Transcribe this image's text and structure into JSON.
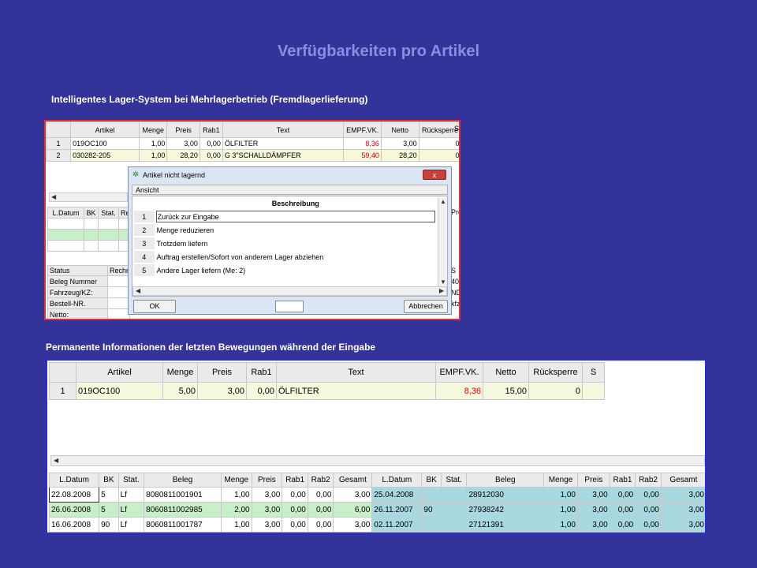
{
  "page": {
    "title": "Verfügbarkeiten pro Artikel",
    "section1_caption": "Intelligentes Lager-System  bei Mehrlagerbetrieb  (Fremdlagerlieferung)",
    "section2_caption": "Permanente Informationen der letzten Bewegungen  während der Eingabe"
  },
  "colors": {
    "background": "#333399",
    "title": "#8c8ce0",
    "frame1": "#e03030",
    "frame2": "#2a2ae0",
    "price_red": "#e00000"
  },
  "shot1": {
    "headers": [
      "",
      "Artikel",
      "Menge",
      "Preis",
      "Rab1",
      "Text",
      "EMPF.VK.",
      "Netto",
      "Rücksperre",
      "S"
    ],
    "rows": [
      [
        "1",
        "019OC100",
        "1,00",
        "3,00",
        "0,00",
        "ÖLFILTER",
        "8,36",
        "3,00",
        "0",
        ""
      ],
      [
        "2",
        "030282-205",
        "1,00",
        "28,20",
        "0,00",
        "G 3\"SCHALLDÄMPFER",
        "59,40",
        "28,20",
        "0",
        ""
      ]
    ],
    "lower_headers": [
      "L.Datum",
      "BK",
      "Stat.",
      "Re"
    ],
    "info_header": [
      "Status",
      "Rechnu"
    ],
    "info_rows": [
      "Beleg Nummer",
      "Fahrzeug/KZ:",
      "Bestell-NR.",
      "Netto:"
    ],
    "right_fragments": [
      "S",
      "Pre",
      "S",
      "40",
      "ND",
      "kfz"
    ]
  },
  "dialog": {
    "title": "Artikel nicht lagernd",
    "close": "x",
    "menu": "Ansicht",
    "column": "Beschreibung",
    "options": [
      {
        "n": "1",
        "label": "Zurück zur Eingabe"
      },
      {
        "n": "2",
        "label": "Menge reduzieren"
      },
      {
        "n": "3",
        "label": "Trotzdem liefern"
      },
      {
        "n": "4",
        "label": "Auftrag erstellen/Sofort von anderem Lager abziehen"
      },
      {
        "n": "5",
        "label": "Andere Lager liefern (Me: 2)"
      }
    ],
    "ok": "OK",
    "cancel": "Abbrechen"
  },
  "shot2": {
    "headers": [
      "",
      "Artikel",
      "Menge",
      "Preis",
      "Rab1",
      "Text",
      "EMPF.VK.",
      "Netto",
      "Rücksperre",
      "S"
    ],
    "row": [
      "1",
      "019OC100",
      "5,00",
      "3,00",
      "0,00",
      "ÖLFILTER",
      "8,36",
      "15,00",
      "0",
      ""
    ],
    "lower_headers": [
      "L.Datum",
      "BK",
      "Stat.",
      "Beleg",
      "Menge",
      "Preis",
      "Rab1",
      "Rab2",
      "Gesamt",
      "L.Datum",
      "BK",
      "Stat.",
      "Beleg",
      "Menge",
      "Preis",
      "Rab1",
      "Rab2",
      "Gesamt"
    ],
    "lower_rows": [
      [
        "22.08.2008",
        "5",
        "Lf",
        "8080811001901",
        "1,00",
        "3,00",
        "0,00",
        "0,00",
        "3,00",
        "25.04.2008",
        "",
        "",
        "28912030",
        "1,00",
        "3,00",
        "0,00",
        "0,00",
        "3,00"
      ],
      [
        "26.06.2008",
        "5",
        "Lf",
        "8060811002985",
        "2,00",
        "3,00",
        "0,00",
        "0,00",
        "6,00",
        "26.11.2007",
        "90",
        "",
        "27938242",
        "1,00",
        "3,00",
        "0,00",
        "0,00",
        "3,00"
      ],
      [
        "16.06.2008",
        "90",
        "Lf",
        "8060811001787",
        "1,00",
        "3,00",
        "0,00",
        "0,00",
        "3,00",
        "02.11.2007",
        "",
        "",
        "27121391",
        "1,00",
        "3,00",
        "0,00",
        "0,00",
        "3,00"
      ]
    ]
  }
}
